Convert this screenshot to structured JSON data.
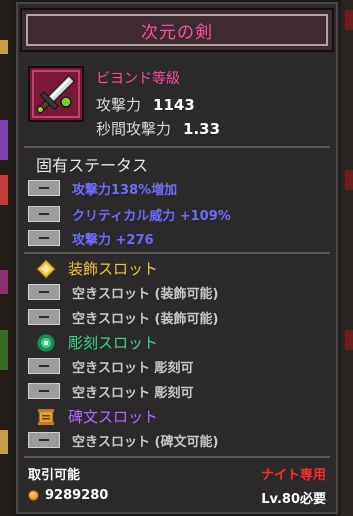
{
  "item": {
    "name": "次元の剣",
    "grade": "ビヨンド等級",
    "attack_label": "攻撃力",
    "attack_value": "1143",
    "speed_label": "秒間攻撃力",
    "speed_value": "1.33",
    "icon": "sword-icon"
  },
  "unique_status": {
    "title": "固有ステータス",
    "lines": [
      "攻撃力138%増加",
      "クリティカル威力 +109%",
      "攻撃力 +276"
    ]
  },
  "accessory_slots": {
    "title": "装飾スロット",
    "icon": "gem-diamond-icon",
    "color": "#f0c43a",
    "slots": [
      "空きスロット (装飾可能)",
      "空きスロット (装飾可能)"
    ]
  },
  "engraving_slots": {
    "title": "彫刻スロット",
    "icon": "engraving-orb-icon",
    "color": "#3dd68a",
    "slots": [
      "空きスロット 彫刻可",
      "空きスロット 彫刻可"
    ]
  },
  "rune_slots": {
    "title": "碑文スロット",
    "icon": "scroll-icon",
    "color": "#b06cff",
    "slots": [
      "空きスロット (碑文可能)"
    ]
  },
  "footer": {
    "tradable": "取引可能",
    "class_restriction": "ナイト専用",
    "price": "9289280",
    "required_level": "Lv.80必要"
  },
  "colors": {
    "grade": "#ff4fa0",
    "status_text": "#6e6cff",
    "restriction": "#ff2a2a"
  }
}
